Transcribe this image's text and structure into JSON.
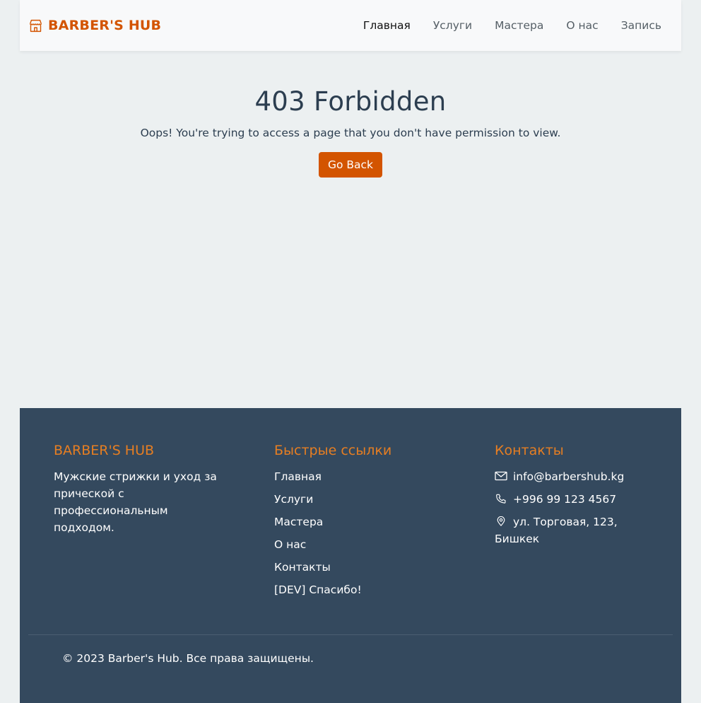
{
  "brand": {
    "name": "BARBER'S HUB",
    "icon": "store-icon",
    "color": "#d35400"
  },
  "nav": {
    "items": [
      {
        "label": "Главная",
        "active": true
      },
      {
        "label": "Услуги",
        "active": false
      },
      {
        "label": "Мастера",
        "active": false
      },
      {
        "label": "О нас",
        "active": false
      },
      {
        "label": "Запись",
        "active": false
      }
    ]
  },
  "error": {
    "title": "403 Forbidden",
    "message": "Oops! You're trying to access a page that you don't have permission to view.",
    "button_label": "Go Back"
  },
  "footer": {
    "about": {
      "title": "BARBER'S HUB",
      "text": "Мужские стрижки и уход за прической с профессиональным подходом."
    },
    "links": {
      "title": "Быстрые ссылки",
      "items": [
        "Главная",
        "Услуги",
        "Мастера",
        "О нас",
        "Контакты",
        "[DEV] Спасибо!"
      ]
    },
    "contacts": {
      "title": "Контакты",
      "email": "info@barbershub.kg",
      "phone": "+996 99 123 4567",
      "address": "ул. Торговая, 123, Бишкек"
    },
    "copyright": "© 2023 Barber's Hub. Все права защищены."
  },
  "colors": {
    "accent": "#d35400",
    "footer_heading": "#e67e22",
    "footer_bg": "#34495e",
    "page_bg": "#ecf0f1",
    "text_dark": "#2c3e50"
  }
}
